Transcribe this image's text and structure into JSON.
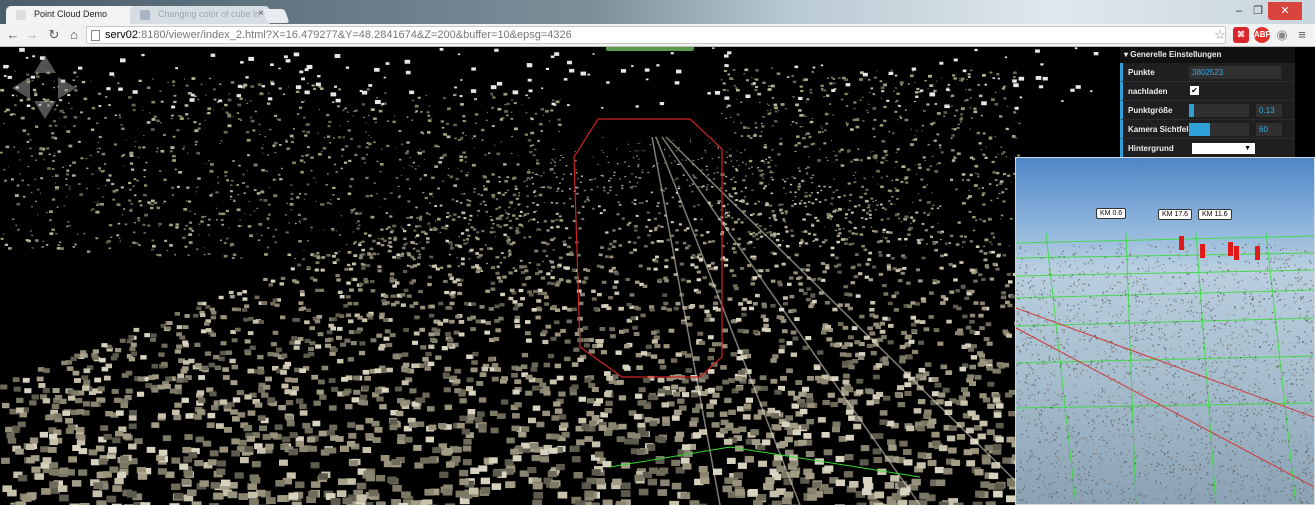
{
  "browser": {
    "tabs": [
      {
        "title": "Point Cloud Demo",
        "active": true
      },
      {
        "title": "Changing color of cube in",
        "active": false
      }
    ],
    "address": {
      "host": "serv02",
      "rest": ":8180/viewer/index_2.html?X=16.479277&Y=48.2841674&Z=200&buffer=10&epsg=4326"
    },
    "nav_icons": [
      "back-icon",
      "forward-icon",
      "reload-icon",
      "home-icon"
    ],
    "extensions": [
      "bookmark-star-icon",
      "pdf-extension-icon",
      "adblock-icon",
      "chrome-extension-icon",
      "menu-icon"
    ],
    "window_controls": [
      "minimize",
      "restore",
      "close"
    ]
  },
  "settings": {
    "header": "Generelle Einstellungen",
    "points_label": "Punkte",
    "points_value": "3802523",
    "reload_label": "nachladen",
    "reload_checked": true,
    "point_size_label": "Punktgröße",
    "point_size_value": "0.13",
    "point_size_fraction": 0.08,
    "fov_label": "Kamera Sichtfeld",
    "fov_value": "60",
    "fov_fraction": 0.35,
    "background_label": "Hintergrund"
  },
  "inset": {
    "labels": [
      {
        "text": "KM 0.6"
      },
      {
        "text": "KM 17.6"
      },
      {
        "text": "KM 11.6"
      }
    ]
  },
  "colors": {
    "accent": "#2fa0d8",
    "flag": "#e01919",
    "grid_line": "#33dd33",
    "selection_box": "#cc2222"
  }
}
